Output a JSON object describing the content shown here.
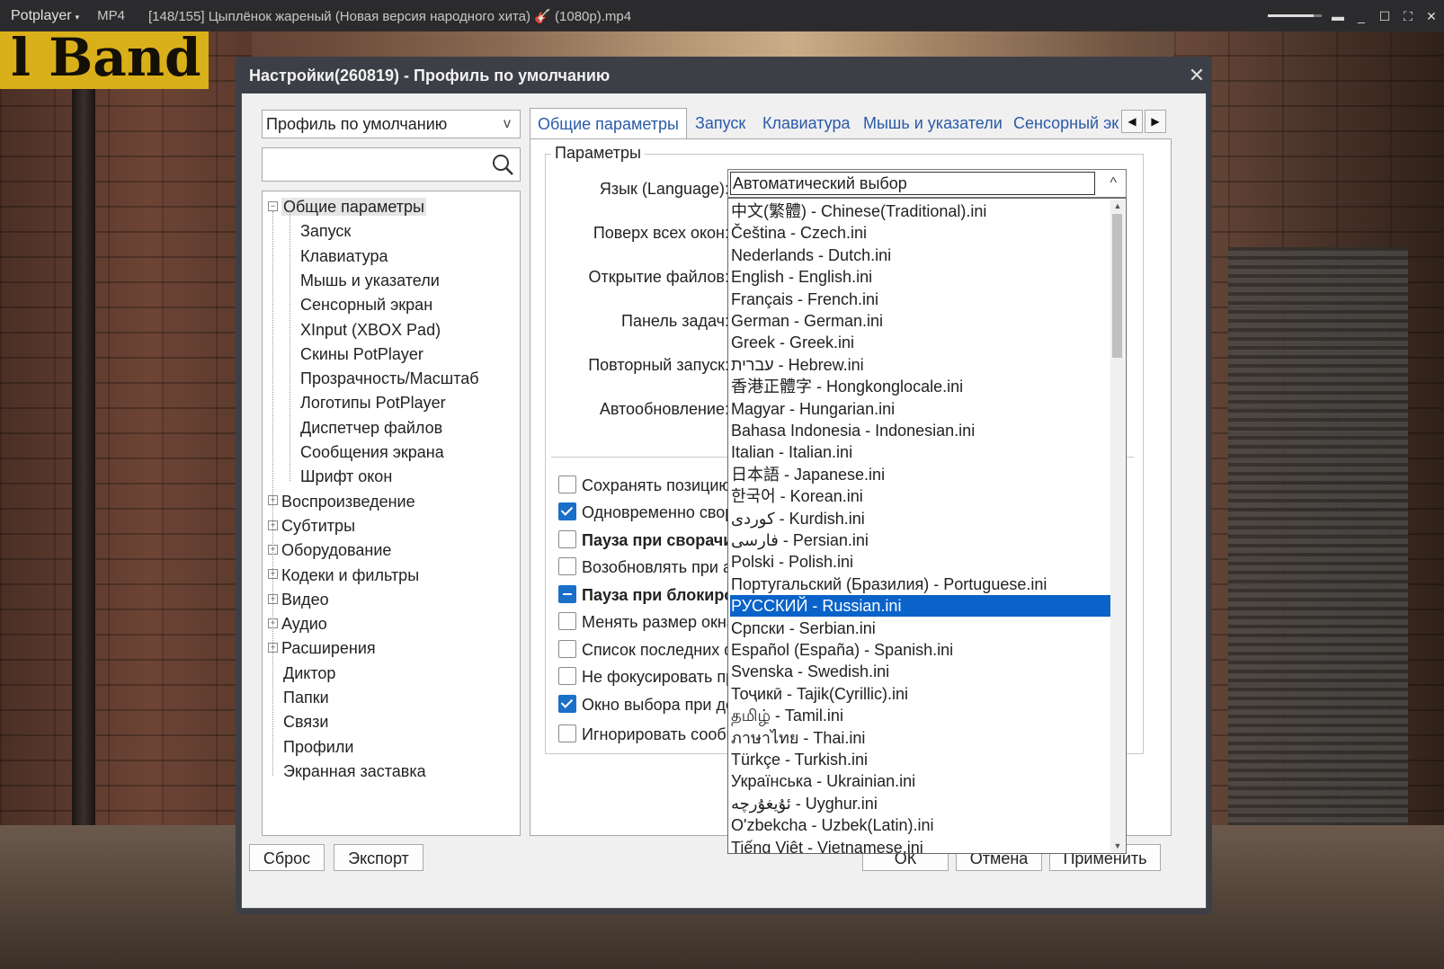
{
  "player": {
    "brand": "Potplayer",
    "brand_arrow": "▾",
    "format": "MP4",
    "title": "[148/155] Цыплёнок жареный (Новая версия народного хита) 🎸 (1080p).mp4",
    "volume_fraction": 0.85
  },
  "video": {
    "logo_text": "l Band"
  },
  "dialog": {
    "title": "Настройки(260819) - Профиль по умолчанию",
    "close_glyph": "✕",
    "profile": {
      "value": "Профиль по умолчанию",
      "chevron": "v"
    },
    "search": {
      "value": "",
      "placeholder": ""
    },
    "tree": [
      {
        "label": "Общие параметры",
        "level": 0,
        "expander": "−",
        "selected": true
      },
      {
        "label": "Запуск",
        "level": 1
      },
      {
        "label": "Клавиатура",
        "level": 1
      },
      {
        "label": "Мышь и указатели",
        "level": 1
      },
      {
        "label": "Сенсорный экран",
        "level": 1
      },
      {
        "label": "XInput (XBOX Pad)",
        "level": 1
      },
      {
        "label": "Скины PotPlayer",
        "level": 1
      },
      {
        "label": "Прозрачность/Масштаб",
        "level": 1
      },
      {
        "label": "Логотипы PotPlayer",
        "level": 1
      },
      {
        "label": "Диспетчер файлов",
        "level": 1
      },
      {
        "label": "Сообщения экрана",
        "level": 1
      },
      {
        "label": "Шрифт окон",
        "level": 1
      },
      {
        "label": "Воспроизведение",
        "level": 0,
        "expander": "+"
      },
      {
        "label": "Субтитры",
        "level": 0,
        "expander": "+"
      },
      {
        "label": "Оборудование",
        "level": 0,
        "expander": "+"
      },
      {
        "label": "Кодеки и фильтры",
        "level": 0,
        "expander": "+"
      },
      {
        "label": "Видео",
        "level": 0,
        "expander": "+"
      },
      {
        "label": "Аудио",
        "level": 0,
        "expander": "+"
      },
      {
        "label": "Расширения",
        "level": 0,
        "expander": "+"
      },
      {
        "label": "Диктор",
        "level": 0
      },
      {
        "label": "Папки",
        "level": 0
      },
      {
        "label": "Связи",
        "level": 0
      },
      {
        "label": "Профили",
        "level": 0
      },
      {
        "label": "Экранная заставка",
        "level": 0
      }
    ],
    "tabs": [
      {
        "label": "Общие параметры",
        "active": true
      },
      {
        "label": "Запуск"
      },
      {
        "label": "Клавиатура"
      },
      {
        "label": "Мышь и указатели"
      },
      {
        "label": "Сенсорный эк"
      }
    ],
    "tab_prev": "◀",
    "tab_next": "▶",
    "params": {
      "group_title": "Параметры",
      "labels": [
        "Язык (Language):",
        "Поверх всех окон:",
        "Открытие файлов:",
        "Панель задач:",
        "Повторный запуск:",
        "Автообновление:"
      ]
    },
    "checkboxes": [
      {
        "label": "Сохранять позицию г",
        "state": "off",
        "bold": false
      },
      {
        "label": "Одновременно свора",
        "state": "on",
        "bold": false
      },
      {
        "label": "Пауза при сворачив",
        "state": "off",
        "bold": true
      },
      {
        "label": "Возобновлять при акт",
        "state": "off",
        "bold": false
      },
      {
        "label": "Пауза при блокиров",
        "state": "indeterminate",
        "bold": true
      },
      {
        "label": "Менять размер окна",
        "state": "off",
        "bold": false
      },
      {
        "label": "Список последних фа",
        "state": "off",
        "bold": false
      },
      {
        "label": "Не фокусировать при",
        "state": "off",
        "bold": false
      },
      {
        "label": "Окно выбора при до",
        "state": "on",
        "bold": false
      },
      {
        "label": "Игнорировать сообщ",
        "state": "off",
        "bold": false
      }
    ],
    "language": {
      "value": "Автоматический выбор",
      "chevron": "^",
      "scroll_up": "▲",
      "scroll_down": "▼",
      "options": [
        "中文(繁體) - Chinese(Traditional).ini",
        "Čeština - Czech.ini",
        "Nederlands - Dutch.ini",
        "English - English.ini",
        "Français - French.ini",
        "German - German.ini",
        "Greek - Greek.ini",
        "עברית - Hebrew.ini",
        "香港正體字 - Hongkonglocale.ini",
        "Magyar - Hungarian.ini",
        "Bahasa Indonesia - Indonesian.ini",
        "Italian - Italian.ini",
        "日本語 - Japanese.ini",
        "한국어 - Korean.ini",
        "کوردی - Kurdish.ini",
        "فارسی - Persian.ini",
        "Polski - Polish.ini",
        "Португальский (Бразилия) - Portuguese.ini",
        "РУССКИЙ - Russian.ini",
        "Српски - Serbian.ini",
        "Español (España) - Spanish.ini",
        "Svenska - Swedish.ini",
        "Тоҷикӣ - Tajik(Cyrillic).ini",
        "தமிழ் - Tamil.ini",
        "ภาษาไทย - Thai.ini",
        "Türkçe - Turkish.ini",
        "Українська - Ukrainian.ini",
        "ئۇيغۇرچە - Uyghur.ini",
        "O'zbekcha - Uzbek(Latin).ini",
        "Tiếng Việt - Vietnamese.ini"
      ],
      "selected_index": 18
    },
    "buttons": {
      "reset": "Сброс",
      "export": "Экспорт",
      "ok": "ОК",
      "cancel": "Отмена",
      "apply": "Применить"
    }
  }
}
